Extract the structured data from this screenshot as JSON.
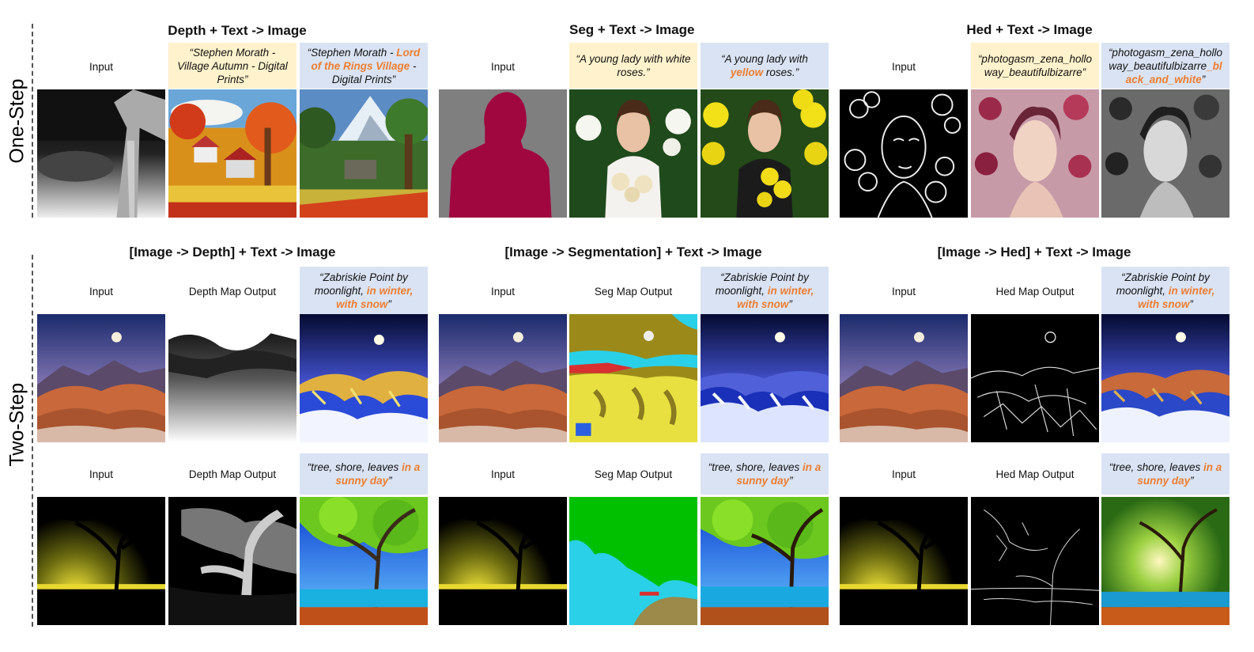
{
  "row_labels": {
    "one_step": "One-Step",
    "two_step": "Two-Step"
  },
  "one_step": {
    "groups": [
      {
        "title": "Depth + Text -> Image",
        "input_label": "Input",
        "prompt_a": [
          "“Stephen Morath - Village Autumn - Digital Prints”"
        ],
        "prompt_b": [
          "“Stephen Morath - ",
          "Lord of the Rings Village",
          " - Digital Prints”"
        ]
      },
      {
        "title": "Seg + Text -> Image",
        "input_label": "Input",
        "prompt_a": [
          "“A young lady with white roses.”"
        ],
        "prompt_b": [
          "“A young lady with ",
          "yellow",
          " roses.”"
        ]
      },
      {
        "title": "Hed + Text -> Image",
        "input_label": "Input",
        "prompt_a": [
          "“photogasm_zena_hollo way_beautifulbizarre”"
        ],
        "prompt_b": [
          "“photogasm_zena_hollo way_beautifulbizarre",
          "_bl ack_and_white",
          "”"
        ]
      }
    ]
  },
  "two_step": {
    "groups": [
      {
        "title": "[Image -> Depth] + Text -> Image",
        "input_label": "Input",
        "map_label": "Depth Map Output",
        "prompt_1": [
          "“Zabriskie Point by moonlight, ",
          "in winter, with snow",
          "”"
        ],
        "prompt_2": [
          "“tree, shore, leaves ",
          "in a sunny day",
          "”"
        ]
      },
      {
        "title": "[Image -> Segmentation] + Text -> Image",
        "input_label": "Input",
        "map_label": "Seg Map Output",
        "prompt_1": [
          "“Zabriskie Point by moonlight, ",
          "in winter, with snow",
          "”"
        ],
        "prompt_2": [
          "“tree, shore, leaves ",
          "in a sunny day",
          "”"
        ]
      },
      {
        "title": "[Image -> Hed] + Text -> Image",
        "input_label": "Input",
        "map_label": "Hed Map Output",
        "prompt_1": [
          "“Zabriskie Point by moonlight, ",
          "in winter, with snow",
          "”"
        ],
        "prompt_2": [
          "“tree, shore, leaves ",
          "in a sunny day",
          "”"
        ]
      }
    ]
  },
  "colors": {
    "highlight": "#ed7d31",
    "yellow_box": "#fff2cc",
    "blue_box": "#dae3f3"
  }
}
